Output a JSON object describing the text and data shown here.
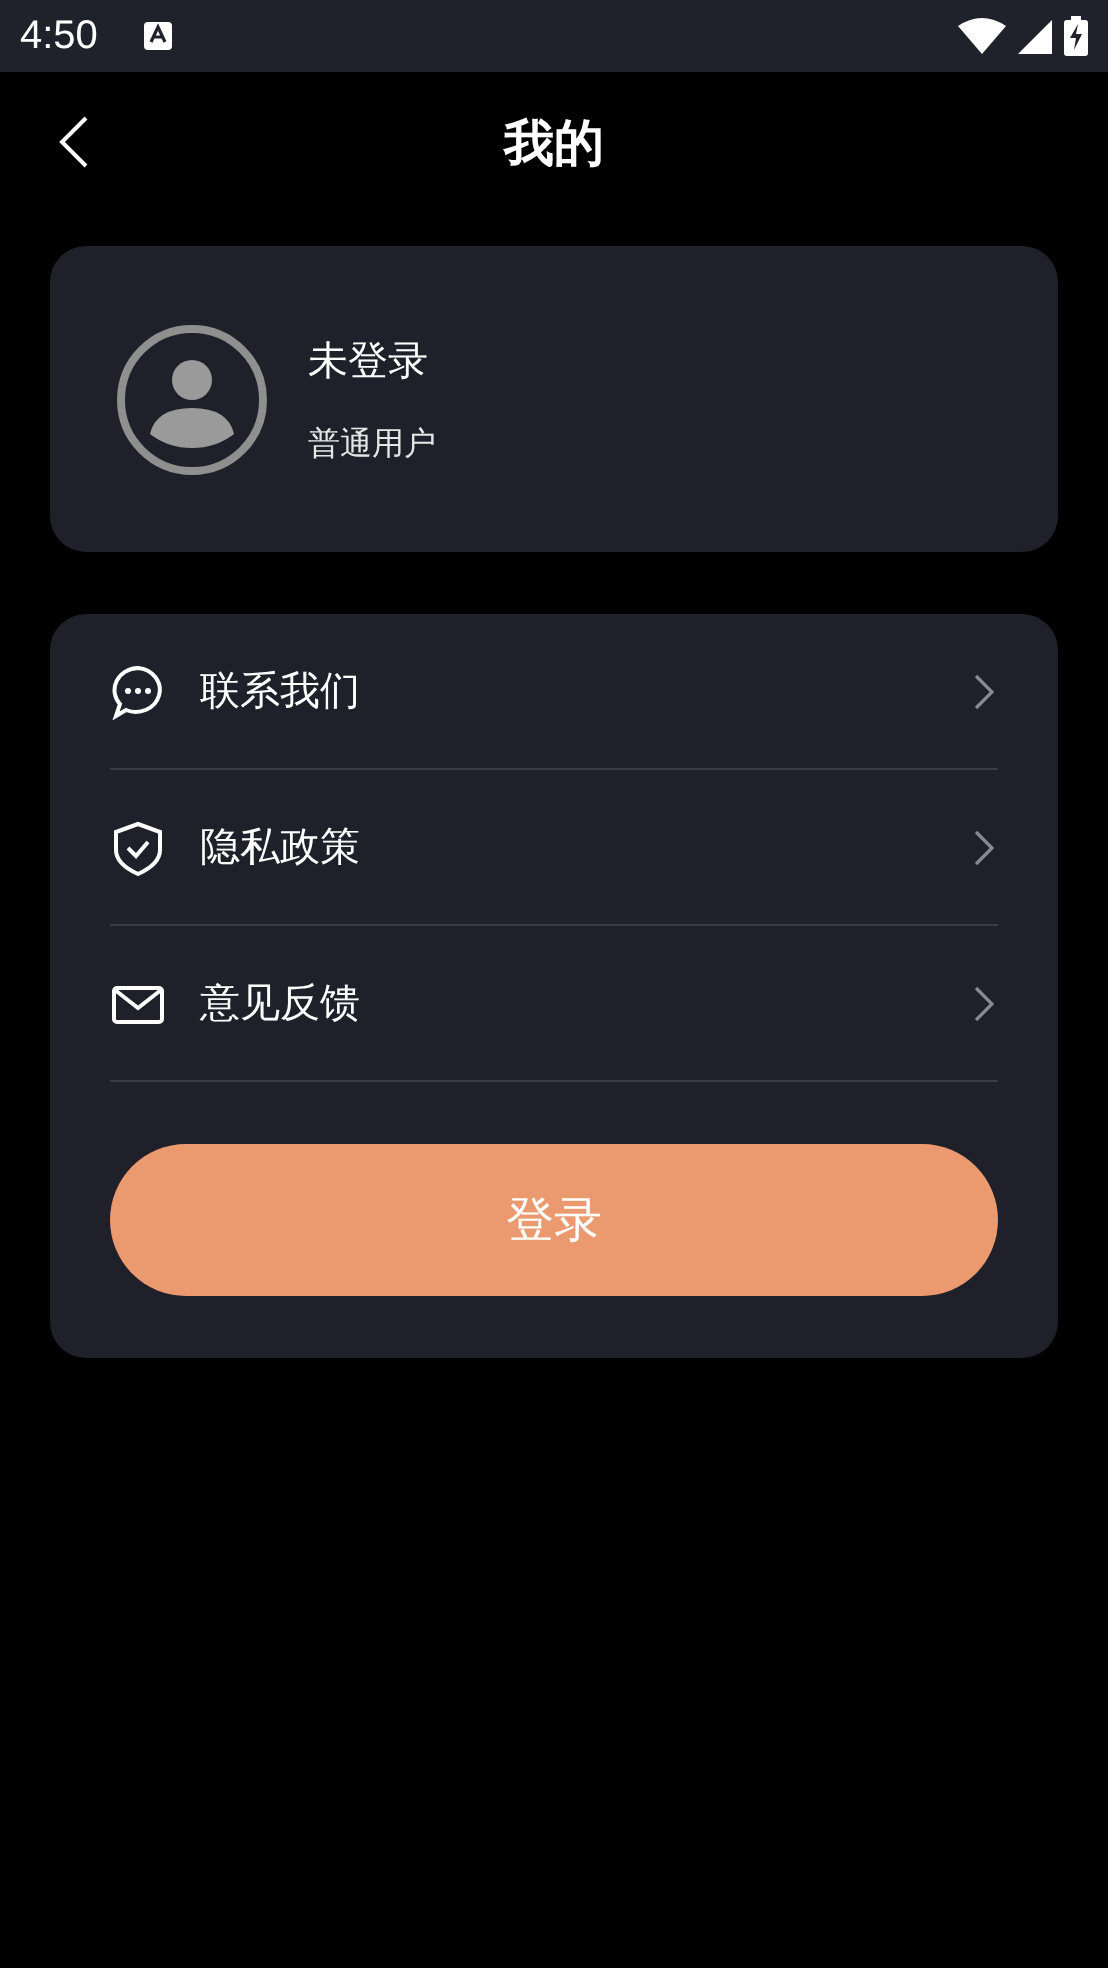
{
  "status_bar": {
    "time": "4:50"
  },
  "header": {
    "title": "我的"
  },
  "profile": {
    "name": "未登录",
    "role": "普通用户"
  },
  "menu": [
    {
      "kind": "chat",
      "label": "联系我们"
    },
    {
      "kind": "shield",
      "label": "隐私政策"
    },
    {
      "kind": "mail",
      "label": "意见反馈"
    }
  ],
  "login_button": "登录"
}
